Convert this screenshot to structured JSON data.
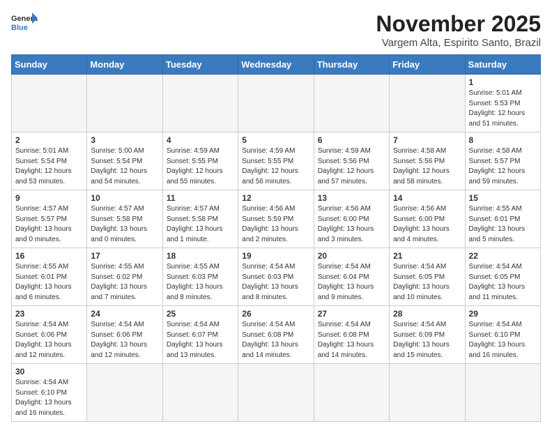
{
  "header": {
    "logo_line1": "General",
    "logo_line2": "Blue",
    "month_title": "November 2025",
    "location": "Vargem Alta, Espirito Santo, Brazil"
  },
  "days_of_week": [
    "Sunday",
    "Monday",
    "Tuesday",
    "Wednesday",
    "Thursday",
    "Friday",
    "Saturday"
  ],
  "weeks": [
    [
      {
        "day": "",
        "info": ""
      },
      {
        "day": "",
        "info": ""
      },
      {
        "day": "",
        "info": ""
      },
      {
        "day": "",
        "info": ""
      },
      {
        "day": "",
        "info": ""
      },
      {
        "day": "",
        "info": ""
      },
      {
        "day": "1",
        "info": "Sunrise: 5:01 AM\nSunset: 5:53 PM\nDaylight: 12 hours\nand 51 minutes."
      }
    ],
    [
      {
        "day": "2",
        "info": "Sunrise: 5:01 AM\nSunset: 5:54 PM\nDaylight: 12 hours\nand 53 minutes."
      },
      {
        "day": "3",
        "info": "Sunrise: 5:00 AM\nSunset: 5:54 PM\nDaylight: 12 hours\nand 54 minutes."
      },
      {
        "day": "4",
        "info": "Sunrise: 4:59 AM\nSunset: 5:55 PM\nDaylight: 12 hours\nand 55 minutes."
      },
      {
        "day": "5",
        "info": "Sunrise: 4:59 AM\nSunset: 5:55 PM\nDaylight: 12 hours\nand 56 minutes."
      },
      {
        "day": "6",
        "info": "Sunrise: 4:59 AM\nSunset: 5:56 PM\nDaylight: 12 hours\nand 57 minutes."
      },
      {
        "day": "7",
        "info": "Sunrise: 4:58 AM\nSunset: 5:56 PM\nDaylight: 12 hours\nand 58 minutes."
      },
      {
        "day": "8",
        "info": "Sunrise: 4:58 AM\nSunset: 5:57 PM\nDaylight: 12 hours\nand 59 minutes."
      }
    ],
    [
      {
        "day": "9",
        "info": "Sunrise: 4:57 AM\nSunset: 5:57 PM\nDaylight: 13 hours\nand 0 minutes."
      },
      {
        "day": "10",
        "info": "Sunrise: 4:57 AM\nSunset: 5:58 PM\nDaylight: 13 hours\nand 0 minutes."
      },
      {
        "day": "11",
        "info": "Sunrise: 4:57 AM\nSunset: 5:58 PM\nDaylight: 13 hours\nand 1 minute."
      },
      {
        "day": "12",
        "info": "Sunrise: 4:56 AM\nSunset: 5:59 PM\nDaylight: 13 hours\nand 2 minutes."
      },
      {
        "day": "13",
        "info": "Sunrise: 4:56 AM\nSunset: 6:00 PM\nDaylight: 13 hours\nand 3 minutes."
      },
      {
        "day": "14",
        "info": "Sunrise: 4:56 AM\nSunset: 6:00 PM\nDaylight: 13 hours\nand 4 minutes."
      },
      {
        "day": "15",
        "info": "Sunrise: 4:55 AM\nSunset: 6:01 PM\nDaylight: 13 hours\nand 5 minutes."
      }
    ],
    [
      {
        "day": "16",
        "info": "Sunrise: 4:55 AM\nSunset: 6:01 PM\nDaylight: 13 hours\nand 6 minutes."
      },
      {
        "day": "17",
        "info": "Sunrise: 4:55 AM\nSunset: 6:02 PM\nDaylight: 13 hours\nand 7 minutes."
      },
      {
        "day": "18",
        "info": "Sunrise: 4:55 AM\nSunset: 6:03 PM\nDaylight: 13 hours\nand 8 minutes."
      },
      {
        "day": "19",
        "info": "Sunrise: 4:54 AM\nSunset: 6:03 PM\nDaylight: 13 hours\nand 8 minutes."
      },
      {
        "day": "20",
        "info": "Sunrise: 4:54 AM\nSunset: 6:04 PM\nDaylight: 13 hours\nand 9 minutes."
      },
      {
        "day": "21",
        "info": "Sunrise: 4:54 AM\nSunset: 6:05 PM\nDaylight: 13 hours\nand 10 minutes."
      },
      {
        "day": "22",
        "info": "Sunrise: 4:54 AM\nSunset: 6:05 PM\nDaylight: 13 hours\nand 11 minutes."
      }
    ],
    [
      {
        "day": "23",
        "info": "Sunrise: 4:54 AM\nSunset: 6:06 PM\nDaylight: 13 hours\nand 12 minutes."
      },
      {
        "day": "24",
        "info": "Sunrise: 4:54 AM\nSunset: 6:06 PM\nDaylight: 13 hours\nand 12 minutes."
      },
      {
        "day": "25",
        "info": "Sunrise: 4:54 AM\nSunset: 6:07 PM\nDaylight: 13 hours\nand 13 minutes."
      },
      {
        "day": "26",
        "info": "Sunrise: 4:54 AM\nSunset: 6:08 PM\nDaylight: 13 hours\nand 14 minutes."
      },
      {
        "day": "27",
        "info": "Sunrise: 4:54 AM\nSunset: 6:08 PM\nDaylight: 13 hours\nand 14 minutes."
      },
      {
        "day": "28",
        "info": "Sunrise: 4:54 AM\nSunset: 6:09 PM\nDaylight: 13 hours\nand 15 minutes."
      },
      {
        "day": "29",
        "info": "Sunrise: 4:54 AM\nSunset: 6:10 PM\nDaylight: 13 hours\nand 16 minutes."
      }
    ],
    [
      {
        "day": "30",
        "info": "Sunrise: 4:54 AM\nSunset: 6:10 PM\nDaylight: 13 hours\nand 16 minutes."
      },
      {
        "day": "",
        "info": ""
      },
      {
        "day": "",
        "info": ""
      },
      {
        "day": "",
        "info": ""
      },
      {
        "day": "",
        "info": ""
      },
      {
        "day": "",
        "info": ""
      },
      {
        "day": "",
        "info": ""
      }
    ]
  ]
}
